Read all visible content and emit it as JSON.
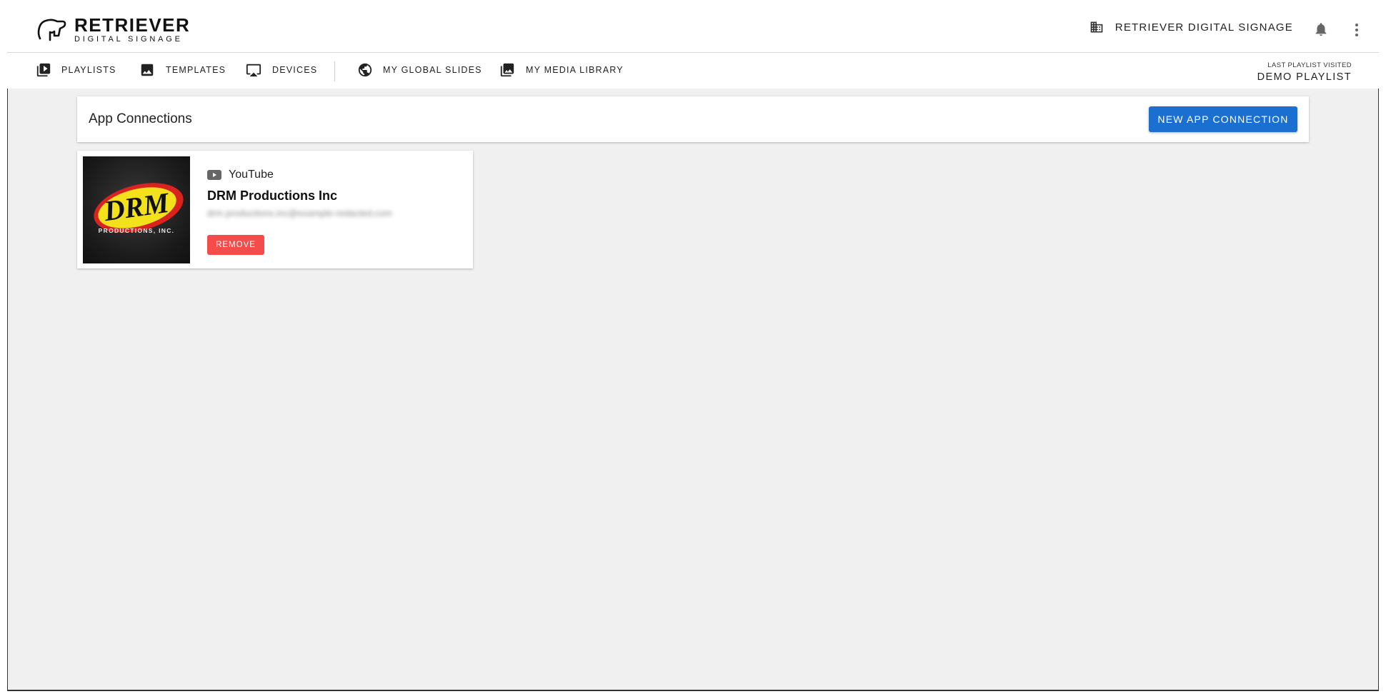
{
  "brand": {
    "title": "RETRIEVER",
    "subtitle": "DIGITAL SIGNAGE"
  },
  "header": {
    "organization": "RETRIEVER DIGITAL SIGNAGE",
    "icons": [
      "building-icon",
      "bell-icon",
      "more-vert-icon"
    ]
  },
  "nav": {
    "items": [
      {
        "label": "PLAYLISTS",
        "icon": "playlist-play-icon"
      },
      {
        "label": "TEMPLATES",
        "icon": "image-icon"
      },
      {
        "label": "DEVICES",
        "icon": "airplay-icon"
      },
      {
        "label": "MY GLOBAL SLIDES",
        "icon": "globe-icon"
      },
      {
        "label": "MY MEDIA LIBRARY",
        "icon": "photo-library-icon"
      }
    ],
    "last_visited_label": "LAST PLAYLIST VISITED",
    "last_visited_value": "DEMO PLAYLIST"
  },
  "page": {
    "title": "App Connections",
    "new_button": "NEW APP CONNECTION"
  },
  "connections": [
    {
      "service": "YouTube",
      "service_icon": "youtube-icon",
      "name": "DRM Productions Inc",
      "email": "drm.productions.inc@example-redacted.com",
      "thumbnail_text": "PRODUCTIONS, INC.",
      "thumbnail_logo": "DRM",
      "remove_label": "REMOVE"
    }
  ],
  "colors": {
    "primary": "#1a6fd1",
    "danger": "#f44b4b",
    "background": "#f0f0f0"
  }
}
